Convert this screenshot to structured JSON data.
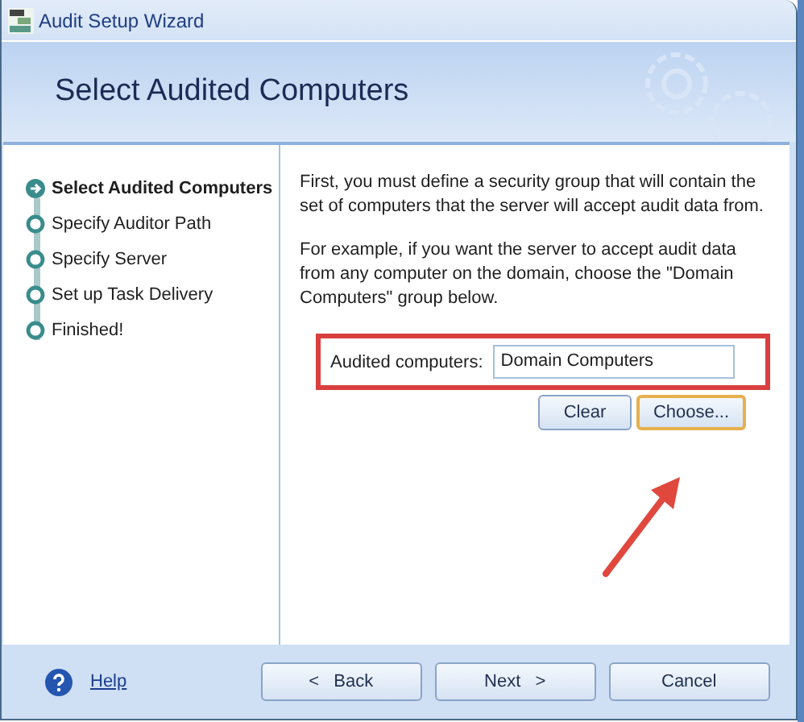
{
  "window": {
    "title": "Audit Setup Wizard"
  },
  "header": {
    "title": "Select Audited Computers"
  },
  "steps": [
    {
      "label": "Select Audited Computers",
      "selected": true
    },
    {
      "label": "Specify Auditor Path",
      "selected": false
    },
    {
      "label": "Specify Server",
      "selected": false
    },
    {
      "label": "Set up Task Delivery",
      "selected": false
    },
    {
      "label": "Finished!",
      "selected": false
    }
  ],
  "paragraphs": [
    "First, you must define a security group that will contain the set of computers that the server will accept audit data from.",
    "For example, if you want the server to accept audit data from any computer on the domain, choose the \"Domain Computers\" group below."
  ],
  "field": {
    "label": "Audited computers:",
    "value": "Domain Computers"
  },
  "field_buttons": [
    {
      "label": "Clear",
      "focused": false
    },
    {
      "label": "Choose...",
      "focused": true
    }
  ],
  "footer": {
    "help": "Help",
    "buttons": [
      "<   Back",
      "Next   >",
      "Cancel"
    ]
  }
}
